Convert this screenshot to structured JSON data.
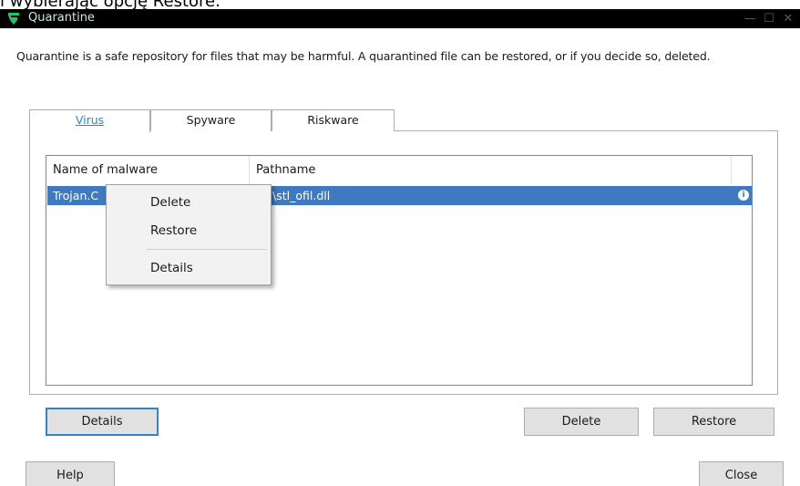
{
  "caption": "i wybierając opcję Restore.",
  "window": {
    "title": "Quarantine",
    "minimize": "—",
    "maximize": "☐",
    "close": "✕"
  },
  "description": "Quarantine is a safe repository for files that may be harmful. A quarantined file can be restored, or if you decide so, deleted.",
  "tabs": [
    {
      "label": "Virus",
      "active": true
    },
    {
      "label": "Spyware",
      "active": false
    },
    {
      "label": "Riskware",
      "active": false
    }
  ],
  "table": {
    "columns": [
      "Name of malware",
      "Pathname"
    ],
    "rows": [
      {
        "name": "Trojan.C",
        "path": "\\stl_ofil.dll",
        "icon": "info-icon"
      }
    ]
  },
  "context_menu": {
    "items": [
      "Delete",
      "Restore",
      "Details"
    ]
  },
  "buttons": {
    "details": "Details",
    "delete": "Delete",
    "restore": "Restore",
    "help": "Help",
    "close": "Close"
  },
  "colors": {
    "accent": "#2f86c8",
    "selection": "#3f79bf",
    "titlebar": "#000000"
  }
}
